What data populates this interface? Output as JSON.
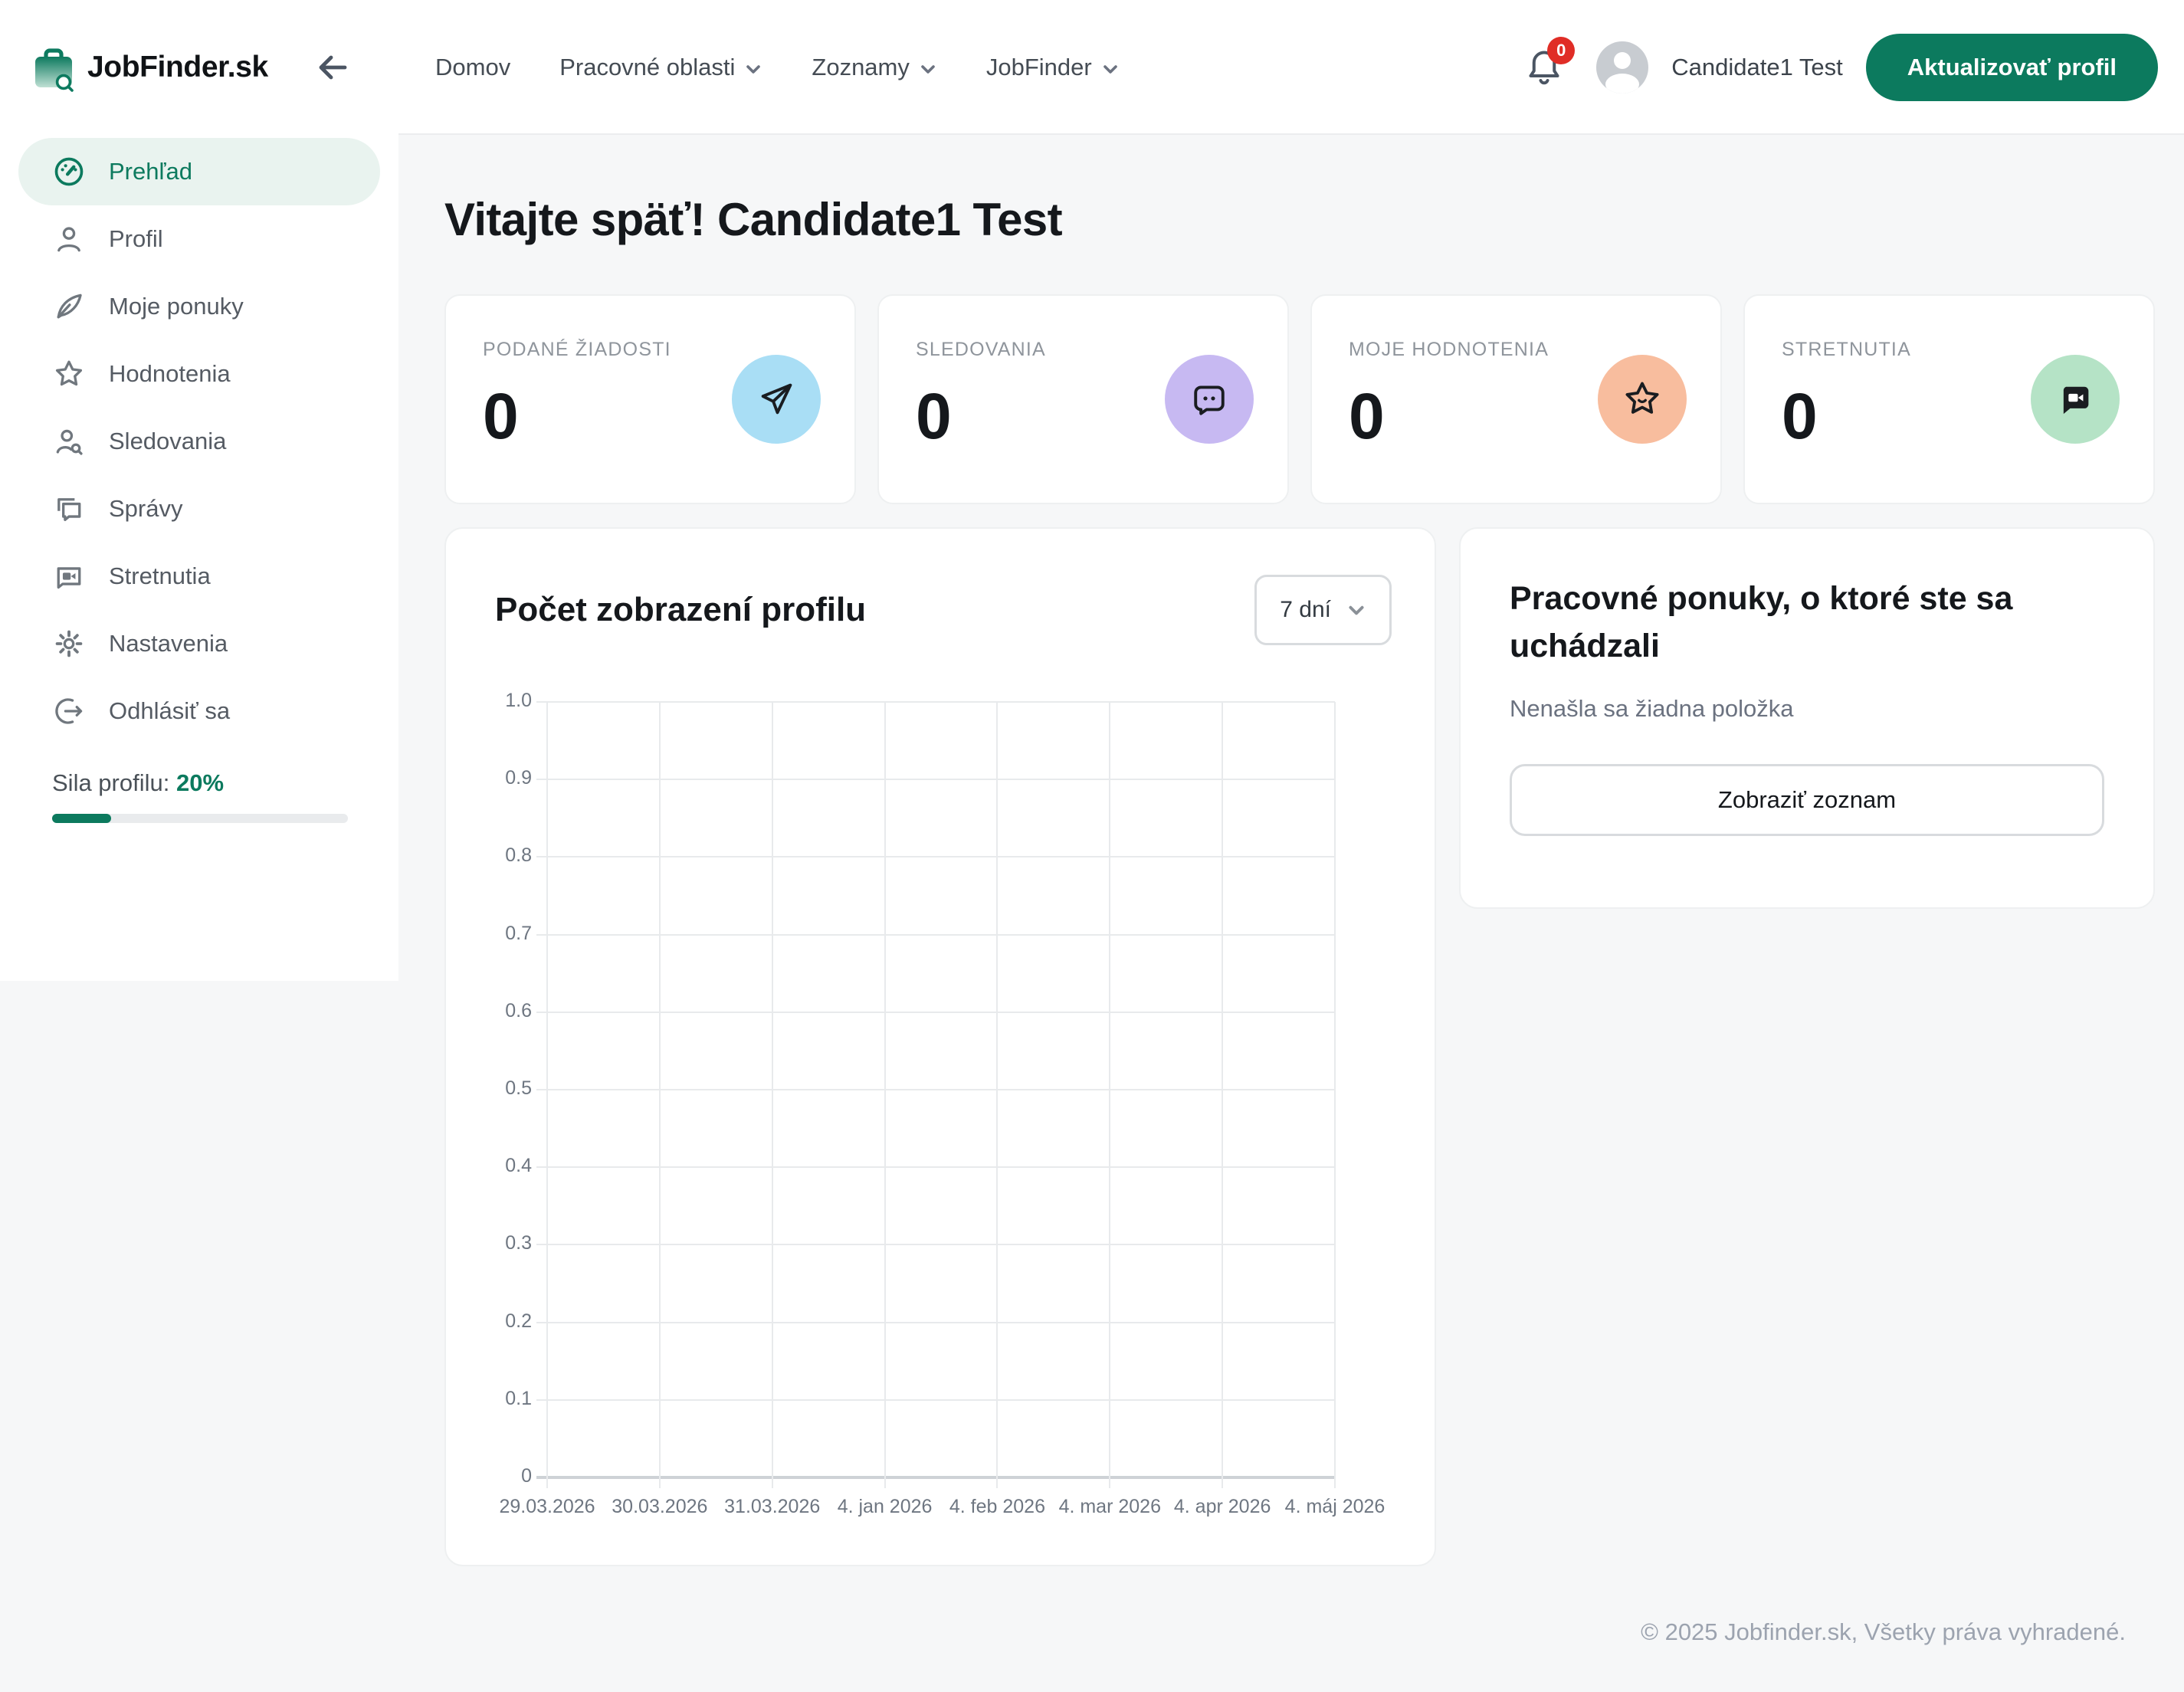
{
  "sidebar": {
    "logo_text": "JobFinder.sk",
    "items": [
      {
        "label": "Prehľad",
        "active": true
      },
      {
        "label": "Profil",
        "active": false
      },
      {
        "label": "Moje ponuky",
        "active": false
      },
      {
        "label": "Hodnotenia",
        "active": false
      },
      {
        "label": "Sledovania",
        "active": false
      },
      {
        "label": "Správy",
        "active": false
      },
      {
        "label": "Stretnutia",
        "active": false
      },
      {
        "label": "Nastavenia",
        "active": false
      },
      {
        "label": "Odhlásiť sa",
        "active": false
      }
    ],
    "profile_strength_label": "Sila profilu:",
    "profile_strength_value": "20%",
    "profile_strength_percent": 20,
    "accent_color": "#0c7a5e"
  },
  "header": {
    "nav": [
      {
        "label": "Domov"
      },
      {
        "label": "Pracovné oblasti"
      },
      {
        "label": "Zoznamy"
      },
      {
        "label": "JobFinder"
      }
    ],
    "notification_count": "0",
    "user_name": "Candidate1 Test",
    "update_profile_button": "Aktualizovať profil"
  },
  "main": {
    "welcome_heading": "Vitajte späť! Candidate1 Test",
    "stat_cards": [
      {
        "label": "PODANÉ ŽIADOSTI",
        "value": "0",
        "icon": "send-icon",
        "circle_color": "#a9def5"
      },
      {
        "label": "SLEDOVANIA",
        "value": "0",
        "icon": "chat-dots-icon",
        "circle_color": "#c7b9f2"
      },
      {
        "label": "MOJE HODNOTENIA",
        "value": "0",
        "icon": "star-smile-icon",
        "circle_color": "#f8bd9e"
      },
      {
        "label": "STRETNUTIA",
        "value": "0",
        "icon": "video-chat-icon",
        "circle_color": "#b5e3c6"
      }
    ],
    "applied_jobs_card": {
      "title": "Pracovné ponuky, o ktoré ste sa uchádzali",
      "empty_text": "Nenašla sa žiadna položka",
      "button_label": "Zobraziť zoznam"
    }
  },
  "chart_data": {
    "type": "line",
    "title": "Počet zobrazení profilu",
    "range_selector": "7 dní",
    "x_labels": [
      "29.03.2026",
      "30.03.2026",
      "31.03.2026",
      "4. jan 2026",
      "4. feb 2026",
      "4. mar 2026",
      "4. apr 2026",
      "4. máj 2026"
    ],
    "y_tick_labels": [
      "1.0",
      "0.9",
      "0.8",
      "0.7",
      "0.6",
      "0.5",
      "0.4",
      "0.3",
      "0.2",
      "0.1",
      "0"
    ],
    "ylim": [
      0,
      1
    ],
    "series": [],
    "grid": true,
    "legend": false
  },
  "footer": {
    "copyright": "© 2025 Jobfinder.sk, Všetky práva vyhradené."
  }
}
